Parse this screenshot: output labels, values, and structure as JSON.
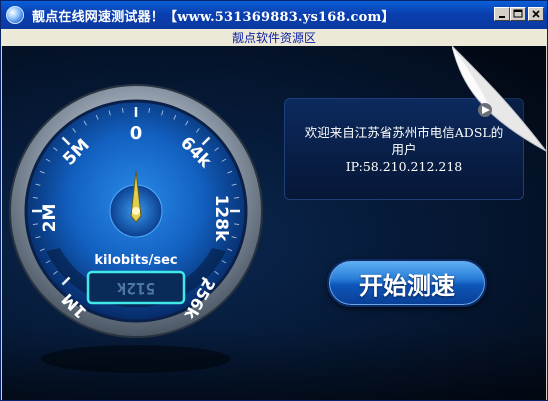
{
  "window": {
    "title": "靓点在线网速测试器！【www.531369883.ys168.com】",
    "menu_link": "靓点软件资源区"
  },
  "gauge": {
    "unit": "kilobits/sec",
    "ticks": [
      "1M",
      "2M",
      "5M",
      "0",
      "64k",
      "128k",
      "256k"
    ],
    "readout": "512k",
    "needle_value": "0"
  },
  "info": {
    "line1": "欢迎来自江苏省苏州市电信ADSL的",
    "line2": "用户",
    "line3": "IP:58.210.212.218"
  },
  "start_button": {
    "label": "开始测速"
  },
  "icons": [
    "app-icon",
    "minimize-icon",
    "maximize-icon",
    "close-icon",
    "play-icon"
  ],
  "colors": {
    "titlebar": "#0a3fb0",
    "panel_bg": "#061a38",
    "gauge_face": "#1a6fd0",
    "needle": "#d8c840",
    "readout_glow": "#40e8e8",
    "button": "#2a7fd8"
  }
}
